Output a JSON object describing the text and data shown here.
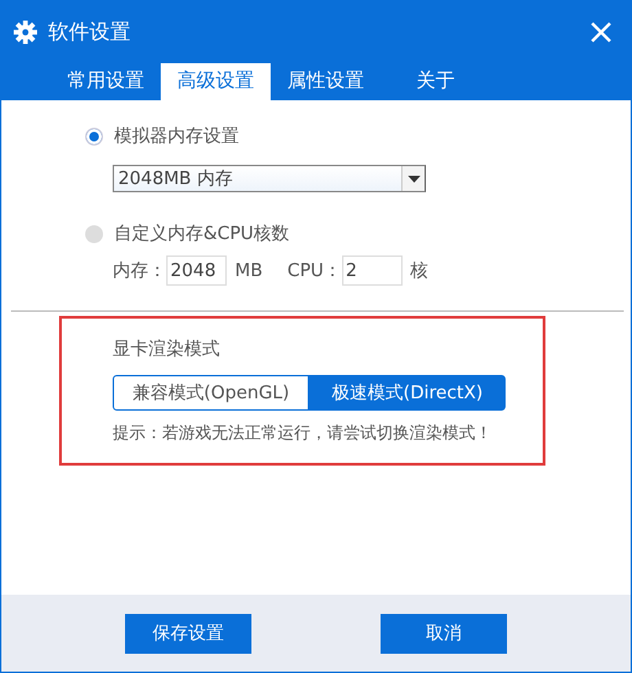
{
  "window": {
    "title": "软件设置"
  },
  "tabs": [
    {
      "label": "常用设置",
      "selected": false
    },
    {
      "label": "高级设置",
      "selected": true
    },
    {
      "label": "属性设置",
      "selected": false
    },
    {
      "label": "关于",
      "selected": false
    }
  ],
  "memory_options": [
    {
      "kind": "dropdown",
      "label": "模拟器内存设置",
      "selected": true,
      "value": "2048MB 内存"
    },
    {
      "kind": "custom",
      "label": "自定义内存&CPU核数",
      "selected": false,
      "memory_label": "内存：",
      "memory_value": "2048",
      "memory_unit": "MB",
      "cpu_label": "CPU：",
      "cpu_value": "2",
      "cpu_unit": "核"
    }
  ],
  "render": {
    "title": "显卡渲染模式",
    "modes": [
      {
        "label": "兼容模式(OpenGL)",
        "selected": false
      },
      {
        "label": "极速模式(DirectX)",
        "selected": true
      }
    ],
    "hint": "提示：若游戏无法正常运行，请尝试切换渲染模式！"
  },
  "buttons": [
    "保存设置",
    "取消"
  ]
}
